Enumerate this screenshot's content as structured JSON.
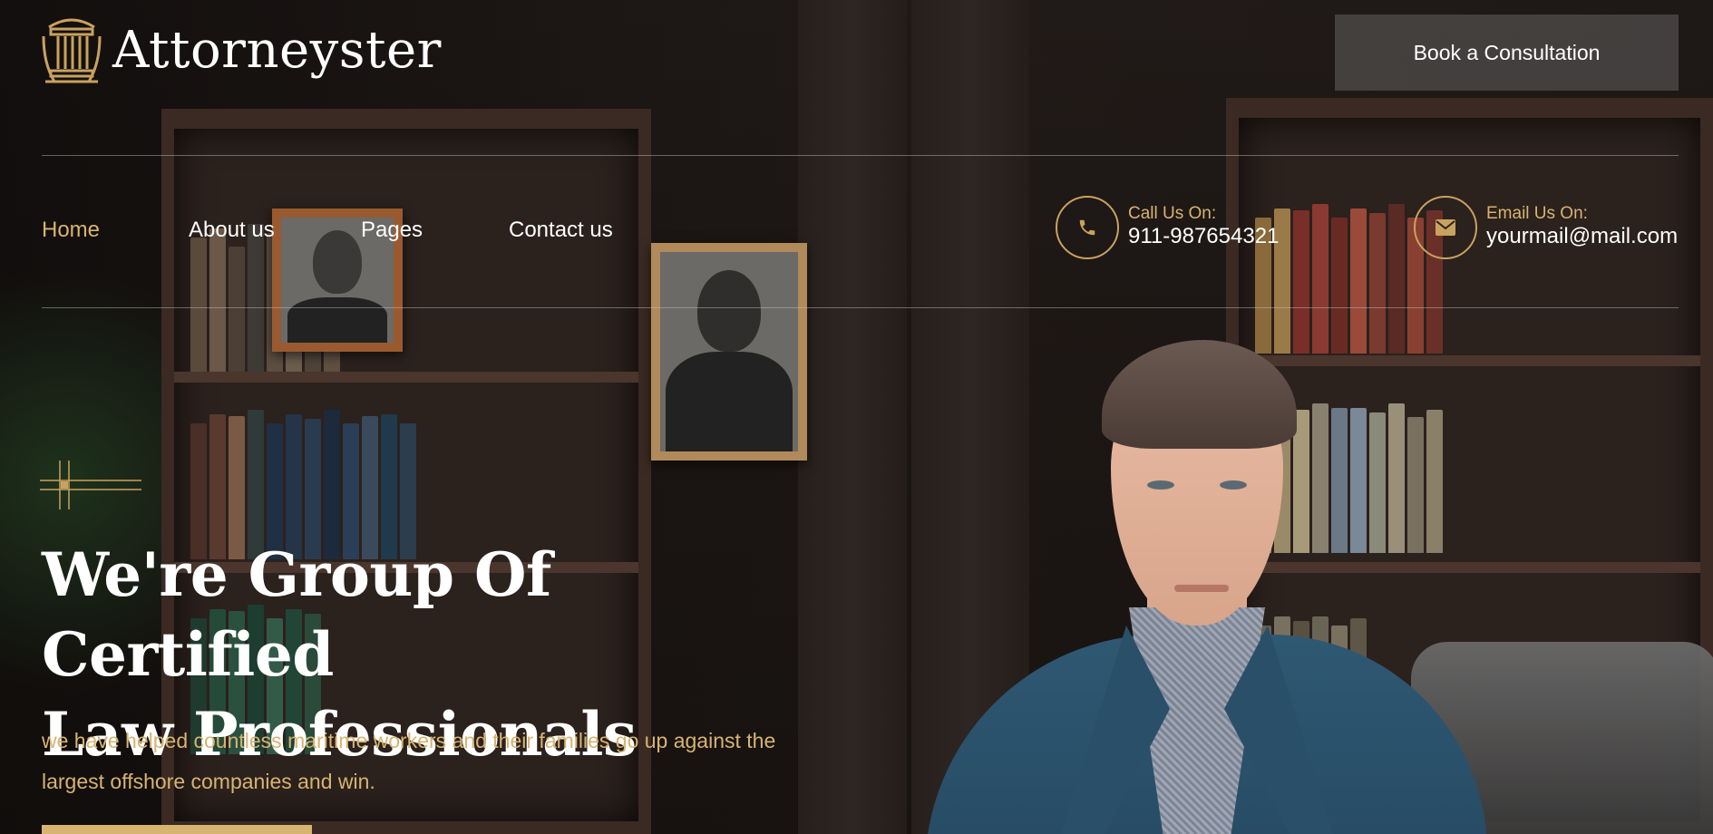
{
  "brand": {
    "name": "Attorneyster",
    "logo_icon": "pillar-logo-icon",
    "accent_color": "#d8b471"
  },
  "header": {
    "cta_label": "Book a Consultation"
  },
  "nav": {
    "items": [
      {
        "label": "Home",
        "active": true
      },
      {
        "label": "About us",
        "active": false
      },
      {
        "label": "Pages",
        "active": false
      },
      {
        "label": "Contact us",
        "active": false
      }
    ]
  },
  "contact": {
    "phone": {
      "icon": "phone-icon",
      "label": "Call Us On:",
      "value": "911-987654321"
    },
    "email": {
      "icon": "mail-icon",
      "label": "Email Us On:",
      "value": "yourmail@mail.com"
    }
  },
  "hero": {
    "headline_line1": "We're Group Of Certified",
    "headline_line2": "Law Professionals",
    "subtext_line1": "we have helped countless maritime workers and their families go up against the",
    "subtext_line2": "largest offshore companies and win.",
    "deco_icon": "crosshair-deco-icon"
  }
}
